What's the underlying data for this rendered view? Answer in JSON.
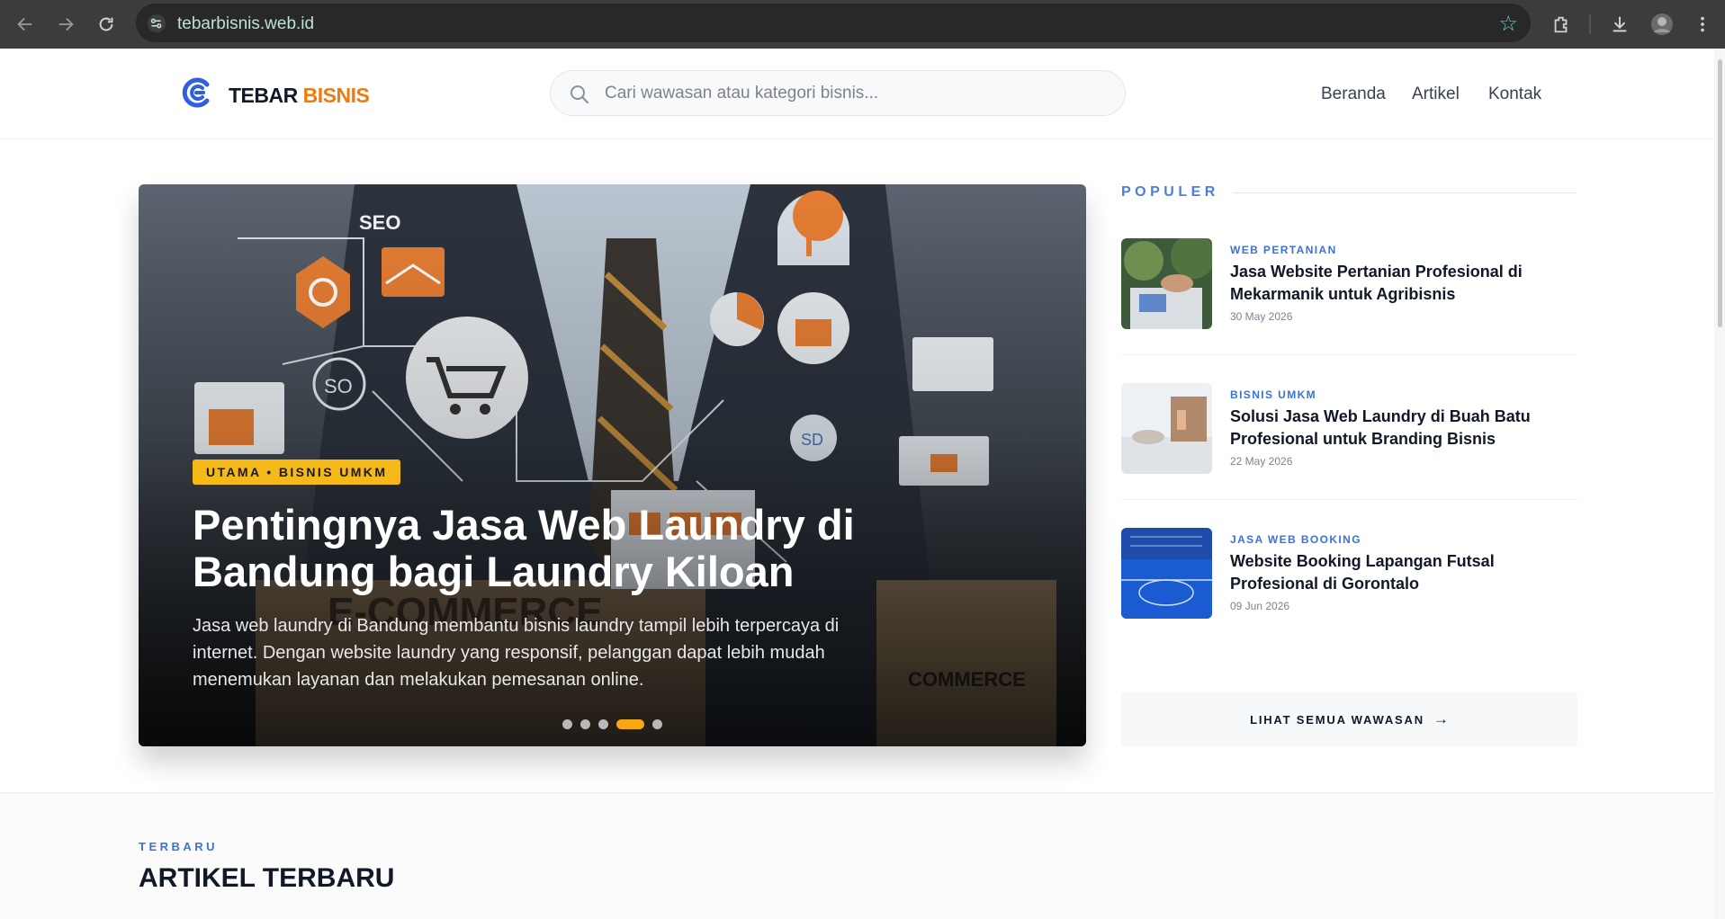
{
  "browser": {
    "url": "tebarbisnis.web.id"
  },
  "site": {
    "logo_primary": "TEBAR",
    "logo_accent": "BISNIS",
    "search_placeholder": "Cari wawasan atau kategori bisnis...",
    "nav": [
      "Beranda",
      "Artikel",
      "Kontak"
    ]
  },
  "hero": {
    "badge": "UTAMA • BISNIS UMKM",
    "title": "Pentingnya Jasa Web Laundry di Bandung bagi Laundry Kiloan",
    "excerpt": "Jasa web laundry di Bandung membantu bisnis laundry tampil lebih terpercaya di internet. Dengan website laundry yang responsif, pelanggan dapat lebih mudah menemukan layanan dan melakukan pemesanan online.",
    "slide_count": 5,
    "active_slide": 4,
    "image_text": [
      "SEO",
      "SO",
      "SD",
      "E-COMMERCE",
      "COMMERCE"
    ]
  },
  "popular": {
    "heading": "POPULER",
    "items": [
      {
        "category": "WEB PERTANIAN",
        "title": "Jasa Website Pertanian Profesional di Mekarmanik untuk Agribisnis",
        "date": "30 May 2026"
      },
      {
        "category": "BISNIS UMKM",
        "title": "Solusi Jasa Web Laundry di Buah Batu Profesional untuk Branding Bisnis",
        "date": "22 May 2026"
      },
      {
        "category": "JASA WEB BOOKING",
        "title": "Website Booking Lapangan Futsal Profesional di Gorontalo",
        "date": "09 Jun 2026"
      }
    ],
    "see_all": "LIHAT SEMUA WAWASAN"
  },
  "latest": {
    "kicker": "TERBARU",
    "title": "ARTIKEL TERBARU"
  },
  "colors": {
    "brand_blue": "#2f5fe0",
    "brand_orange": "#f07a10",
    "badge_yellow": "#f6b91a",
    "accent_blue": "#3b72d9"
  },
  "icons": [
    "back-icon",
    "forward-icon",
    "reload-icon",
    "site-info-icon",
    "bookmark-star-icon",
    "extensions-icon",
    "download-icon",
    "profile-avatar",
    "menu-icon",
    "search-icon",
    "arrow-right-icon"
  ]
}
